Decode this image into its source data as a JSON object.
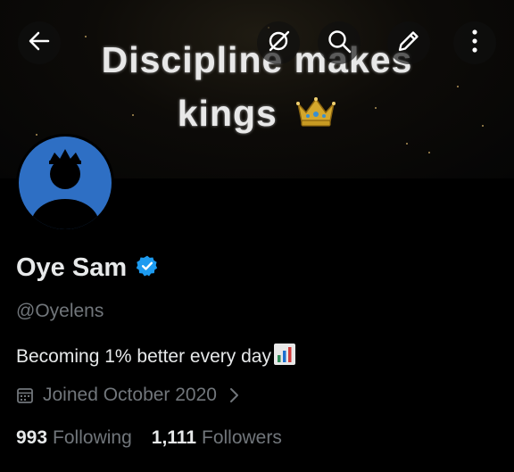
{
  "banner": {
    "line1": "Discipline makes",
    "line2": "kings"
  },
  "header_buttons": {
    "back": "back-arrow-icon",
    "grok": "grok-icon",
    "search": "search-icon",
    "edit": "edit-pencil-icon",
    "more": "more-vertical-icon"
  },
  "profile": {
    "name": "Oye Sam",
    "handle": "@Oyelens",
    "bio": "Becoming 1% better every day",
    "joined": "Joined October 2020",
    "following_count": "993",
    "following_label": "Following",
    "followers_count": "1,111",
    "followers_label": "Followers"
  },
  "colors": {
    "background": "#000000",
    "verified": "#1d9bf0",
    "avatar_bg": "#2e6fc4",
    "secondary_text": "#71767b"
  }
}
